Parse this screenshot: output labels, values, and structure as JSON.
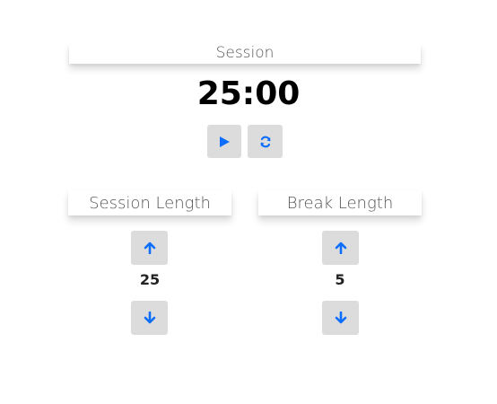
{
  "session": {
    "label": "Session",
    "time_left": "25:00"
  },
  "controls": {
    "play_icon": "play-icon",
    "reset_icon": "refresh-icon"
  },
  "session_length": {
    "label": "Session Length",
    "value": "25",
    "increment_icon": "arrow-up-icon",
    "decrement_icon": "arrow-down-icon"
  },
  "break_length": {
    "label": "Break Length",
    "value": "5",
    "increment_icon": "arrow-up-icon",
    "decrement_icon": "arrow-down-icon"
  },
  "colors": {
    "accent": "#0d6efd",
    "button_bg": "#dcdcdc",
    "title_text": "#555555"
  }
}
